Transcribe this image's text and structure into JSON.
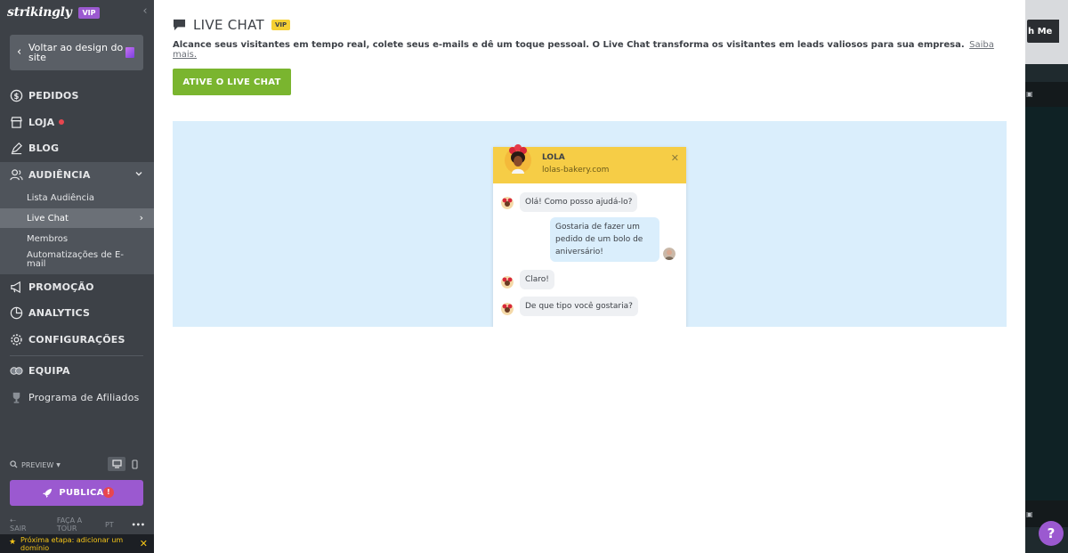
{
  "brand": {
    "logo": "strikingly",
    "badge": "VIP"
  },
  "sidebar": {
    "back_label": "Voltar ao design do site",
    "items": [
      {
        "label": "PEDIDOS"
      },
      {
        "label": "LOJA"
      },
      {
        "label": "BLOG"
      },
      {
        "label": "AUDIÊNCIA"
      },
      {
        "label": "PROMOÇÃO"
      },
      {
        "label": "ANALYTICS"
      },
      {
        "label": "CONFIGURAÇÕES"
      },
      {
        "label": "EQUIPA"
      },
      {
        "label": "Programa de Afiliados"
      }
    ],
    "sub_items": [
      {
        "label": "Lista Audiência"
      },
      {
        "label": "Live Chat"
      },
      {
        "label": "Membros"
      },
      {
        "label": "Automatizações de E-mail"
      }
    ],
    "preview_label": "PREVIEW",
    "publish_label": "PUBLICAR",
    "publish_warning": "!",
    "footer": {
      "exit": "SAIR",
      "tour": "FAÇA A TOUR",
      "lang": "PT",
      "more": "•••"
    },
    "next_step": "Próxima etapa: adicionar um domínio"
  },
  "main": {
    "title": "LIVE CHAT",
    "badge": "VIP",
    "description": "Alcance seus visitantes em tempo real, colete seus e-mails e dê um toque pessoal. O Live Chat transforma os visitantes em leads valiosos para sua empresa.",
    "learn_more": "Saiba mais.",
    "cta_label": "ATIVE O LIVE CHAT"
  },
  "chat_preview": {
    "name": "LOLA",
    "site": "lolas-bakery.com",
    "messages": [
      {
        "from": "agent",
        "text": "Olá! Como posso ajudá-lo?"
      },
      {
        "from": "visitor",
        "text": "Gostaria de fazer um pedido de um bolo de aniversário!"
      },
      {
        "from": "agent",
        "text": "Claro!"
      },
      {
        "from": "agent",
        "text": "De que tipo você gostaria?"
      }
    ]
  },
  "editor_behind": {
    "button_label": "h Me",
    "help": "?"
  },
  "colors": {
    "sidebar": "#3d4147",
    "accent_purple": "#9b59d0",
    "cta_green": "#7ab52f",
    "vip_yellow": "#f5d033",
    "preview_blue": "#daeefc"
  }
}
